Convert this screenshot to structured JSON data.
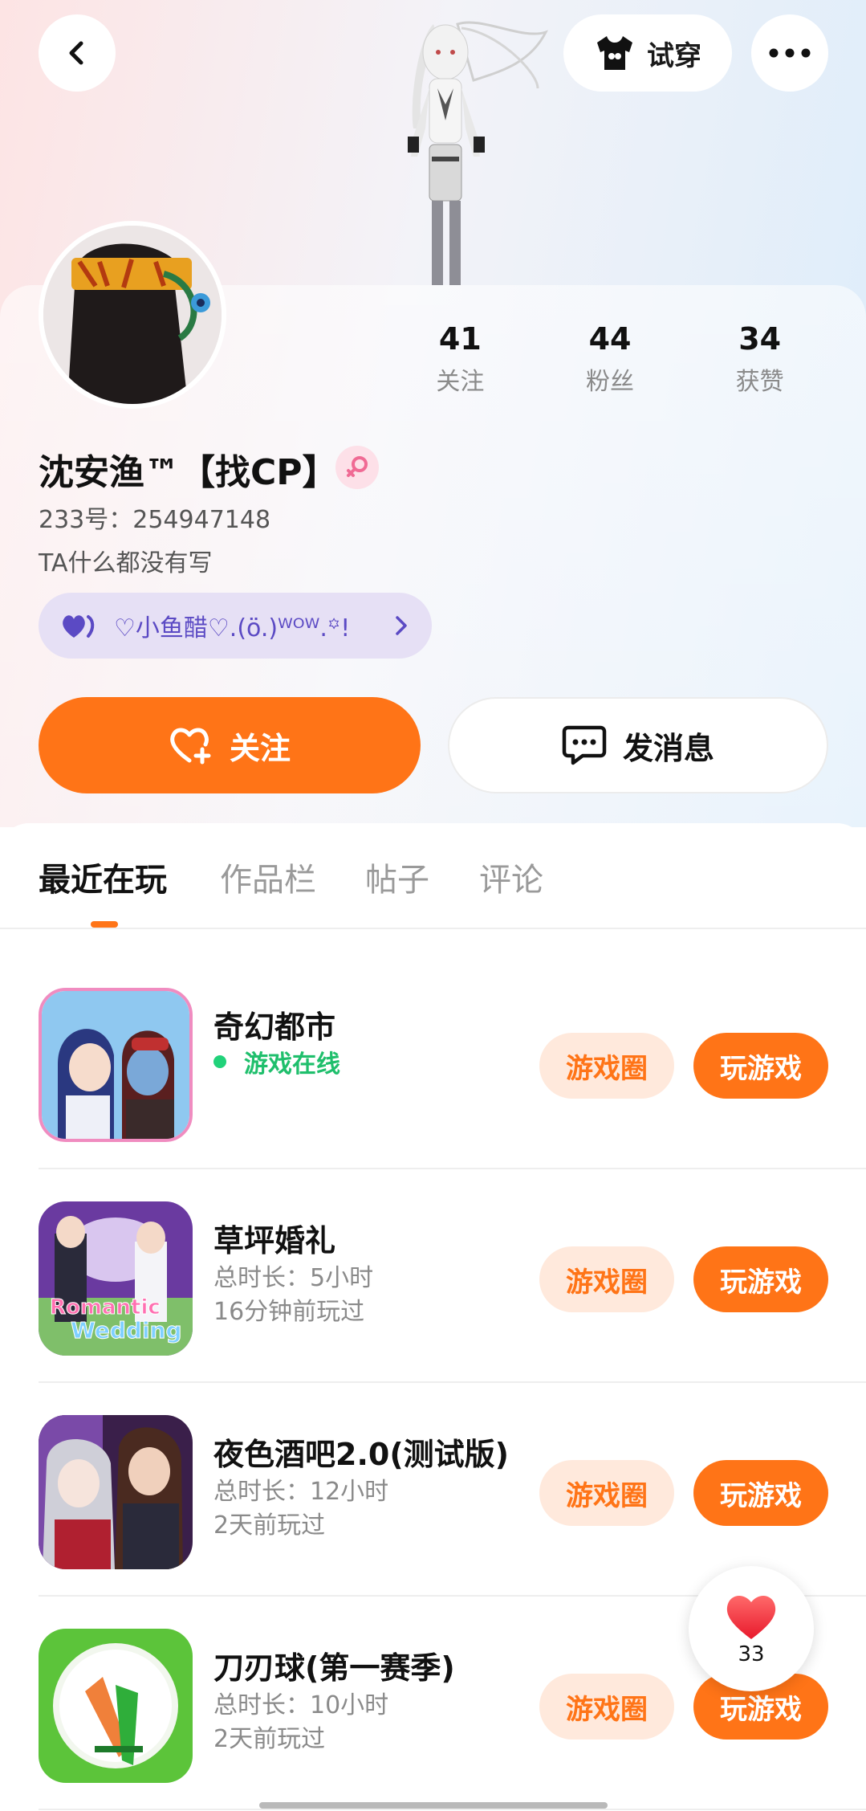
{
  "header": {
    "try_on_label": "试穿"
  },
  "profile": {
    "nickname": "沈安渔™【找CP】",
    "uid_label": "233号：254947148",
    "bio": "TA什么都没有写",
    "tag_text": "♡小鱼醋♡.(ö.)ᵂᴼᵂ.꙳!"
  },
  "stats": [
    {
      "num": "41",
      "label": "关注"
    },
    {
      "num": "44",
      "label": "粉丝"
    },
    {
      "num": "34",
      "label": "获赞"
    }
  ],
  "actions": {
    "follow_label": "关注",
    "message_label": "发消息"
  },
  "tabs": [
    {
      "label": "最近在玩",
      "active": true
    },
    {
      "label": "作品栏",
      "active": false
    },
    {
      "label": "帖子",
      "active": false
    },
    {
      "label": "评论",
      "active": false
    }
  ],
  "games": [
    {
      "title": "奇幻都市",
      "status": "游戏在线",
      "circle_label": "游戏圈",
      "play_label": "玩游戏"
    },
    {
      "title": "草坪婚礼",
      "duration": "总时长：5小时",
      "last_played": "16分钟前玩过",
      "circle_label": "游戏圈",
      "play_label": "玩游戏",
      "icon_text_1": "Romantic",
      "icon_text_2": "Wedding"
    },
    {
      "title": "夜色酒吧2.0(测试版)",
      "duration": "总时长：12小时",
      "last_played": "2天前玩过",
      "circle_label": "游戏圈",
      "play_label": "玩游戏"
    },
    {
      "title": "刀刃球(第一赛季)",
      "duration": "总时长：10小时",
      "last_played": "2天前玩过",
      "circle_label": "游戏圈",
      "play_label": "玩游戏"
    }
  ],
  "like_float": {
    "count": "33"
  },
  "colors": {
    "accent": "#ff7417",
    "online": "#1fbf6c",
    "tag_bg": "#e6e0f5",
    "tag_text": "#5b4ac4"
  }
}
